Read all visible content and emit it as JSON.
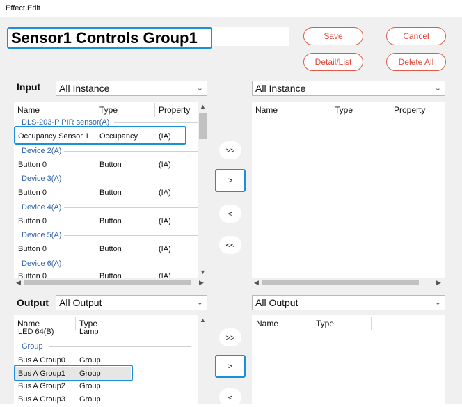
{
  "window": {
    "title": "Effect Edit"
  },
  "effect_name": "Sensor1 Controls Group1",
  "buttons": {
    "save": "Save",
    "cancel": "Cancel",
    "detail_list": "Detail/List",
    "delete_all": "Delete All"
  },
  "input": {
    "label": "Input",
    "filter": "All Instance",
    "columns": [
      "Name",
      "Type",
      "Property"
    ],
    "groups": [
      {
        "name": "DLS-203-P PIR sensor(A)",
        "rows": [
          {
            "name": "Occupancy Sensor 1",
            "type": "Occupancy",
            "property": "(IA)"
          }
        ]
      },
      {
        "name": "Device 2(A)",
        "rows": [
          {
            "name": "Button 0",
            "type": "Button",
            "property": "(IA)"
          }
        ]
      },
      {
        "name": "Device 3(A)",
        "rows": [
          {
            "name": "Button 0",
            "type": "Button",
            "property": "(IA)"
          }
        ]
      },
      {
        "name": "Device 4(A)",
        "rows": [
          {
            "name": "Button 0",
            "type": "Button",
            "property": "(IA)"
          }
        ]
      },
      {
        "name": "Device 5(A)",
        "rows": [
          {
            "name": "Button 0",
            "type": "Button",
            "property": "(IA)"
          }
        ]
      },
      {
        "name": "Device 6(A)",
        "rows": [
          {
            "name": "Button 0",
            "type": "Button",
            "property": "(IA)"
          }
        ]
      }
    ]
  },
  "input_selected": {
    "filter": "All Instance",
    "columns": [
      "Name",
      "Type",
      "Property"
    ]
  },
  "move_buttons_input": {
    "add_all": ">>",
    "add": ">",
    "remove": "<",
    "remove_all": "<<"
  },
  "output": {
    "label": "Output",
    "filter": "All Output",
    "columns": [
      "Name",
      "Type"
    ],
    "partial_row": {
      "name": "LED 64(B)",
      "type": "Lamp"
    },
    "group_name": "Group",
    "rows": [
      {
        "name": "Bus A Group0",
        "type": "Group"
      },
      {
        "name": "Bus A Group1",
        "type": "Group"
      },
      {
        "name": "Bus A Group2",
        "type": "Group"
      },
      {
        "name": "Bus A Group3",
        "type": "Group"
      }
    ]
  },
  "output_selected": {
    "filter": "All Output",
    "columns": [
      "Name",
      "Type"
    ]
  },
  "move_buttons_output": {
    "add_all": ">>",
    "add": ">",
    "remove": "<"
  },
  "icons": {
    "dropdown": "chevron-down-icon",
    "scroll_up": "scroll-up-icon",
    "scroll_down": "scroll-down-icon"
  },
  "colors": {
    "highlight": "#1b8fd9",
    "pill_border": "#e05a4a",
    "pill_text": "#e0453a",
    "group_text": "#2f64a8"
  }
}
